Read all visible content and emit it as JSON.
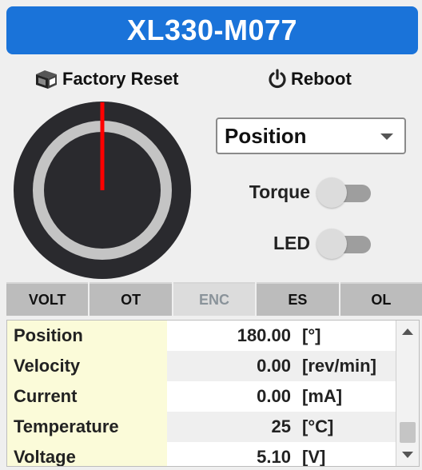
{
  "header": {
    "title": "XL330-M077"
  },
  "actions": {
    "factory_reset": {
      "label": "Factory Reset",
      "icon": "box-icon"
    },
    "reboot": {
      "label": "Reboot",
      "icon": "power-icon"
    }
  },
  "dial": {
    "needle_angle_deg": 0,
    "colors": {
      "outer": "#2a2a2e",
      "ring": "#c4c4c4",
      "needle": "#ff0000"
    }
  },
  "mode_select": {
    "value": "Position"
  },
  "toggles": [
    {
      "label": "Torque",
      "on": false
    },
    {
      "label": "LED",
      "on": false
    }
  ],
  "tabs": [
    {
      "label": "VOLT",
      "active": true
    },
    {
      "label": "OT",
      "active": true
    },
    {
      "label": "ENC",
      "active": false
    },
    {
      "label": "ES",
      "active": true
    },
    {
      "label": "OL",
      "active": true
    }
  ],
  "table": {
    "rows": [
      {
        "name": "Position",
        "value": "180.00",
        "unit": "[°]"
      },
      {
        "name": "Velocity",
        "value": "0.00",
        "unit": "[rev/min]"
      },
      {
        "name": "Current",
        "value": "0.00",
        "unit": "[mA]"
      },
      {
        "name": "Temperature",
        "value": "25",
        "unit": "[°C]"
      },
      {
        "name": "Voltage",
        "value": "5.10",
        "unit": "[V]"
      }
    ]
  },
  "colors": {
    "title_bg": "#1a73d9",
    "name_cell_bg": "#fbfbd9"
  }
}
